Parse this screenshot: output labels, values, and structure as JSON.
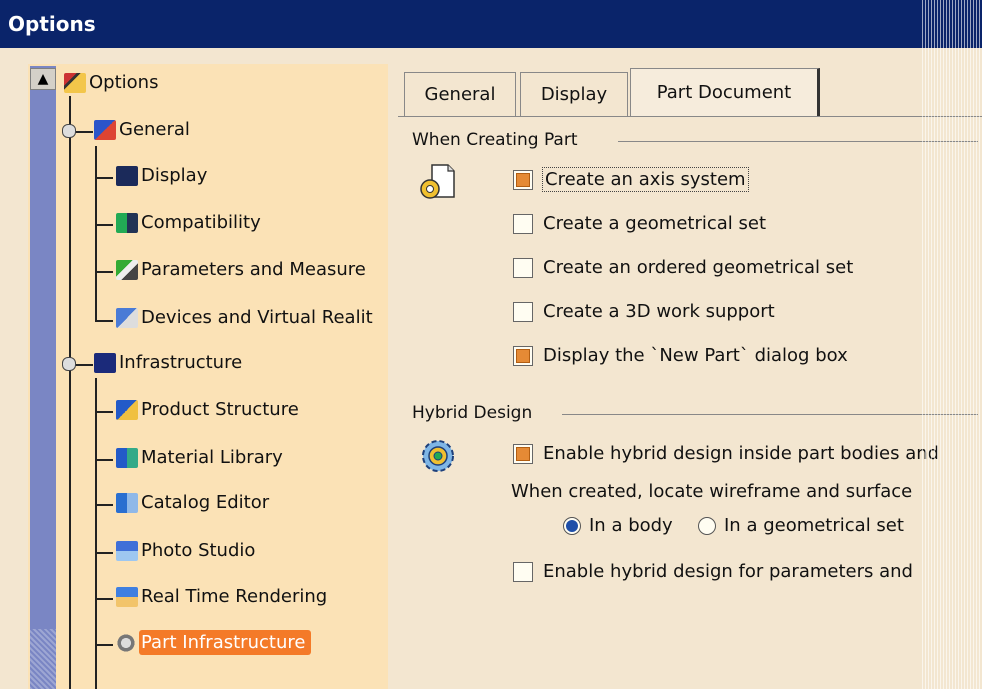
{
  "window": {
    "title": "Options"
  },
  "tree": {
    "root": "Options",
    "items": [
      {
        "label": "General",
        "level": 0
      },
      {
        "label": "Display",
        "level": 1
      },
      {
        "label": "Compatibility",
        "level": 1
      },
      {
        "label": "Parameters and Measure",
        "level": 1
      },
      {
        "label": "Devices and Virtual Realit",
        "level": 1
      },
      {
        "label": "Infrastructure",
        "level": 0
      },
      {
        "label": "Product Structure",
        "level": 1
      },
      {
        "label": "Material Library",
        "level": 1
      },
      {
        "label": "Catalog Editor",
        "level": 1
      },
      {
        "label": "Photo Studio",
        "level": 1
      },
      {
        "label": "Real Time Rendering",
        "level": 1
      },
      {
        "label": "Part Infrastructure",
        "level": 1,
        "selected": true
      }
    ],
    "scroll_up_symbol": "▲"
  },
  "tabs": [
    {
      "label": "General",
      "active": false
    },
    {
      "label": "Display",
      "active": false
    },
    {
      "label": "Part Document",
      "active": true
    }
  ],
  "when_creating_part": {
    "title": "When Creating Part",
    "options": [
      {
        "label": "Create an axis system",
        "checked": true
      },
      {
        "label": "Create a geometrical set",
        "checked": false
      },
      {
        "label": "Create an ordered geometrical set",
        "checked": false
      },
      {
        "label": "Create a 3D work support",
        "checked": false
      },
      {
        "label": "Display the `New Part` dialog box",
        "checked": true
      }
    ]
  },
  "hybrid_design": {
    "title": "Hybrid Design",
    "enable_hybrid": {
      "label": "Enable hybrid design inside part bodies and",
      "checked": true
    },
    "locate_text": "When created, locate wireframe and surface",
    "radio_in_body": {
      "label": "In a body",
      "selected": true
    },
    "radio_in_geo": {
      "label": "In a geometrical set",
      "selected": false
    },
    "enable_params": {
      "label": "Enable hybrid design for parameters and",
      "checked": false
    }
  },
  "colors": {
    "titlebar": "#0a246a",
    "tree_bg": "#fbe2b6",
    "selection": "#f47a28",
    "scrollbar": "#7a86c4"
  }
}
